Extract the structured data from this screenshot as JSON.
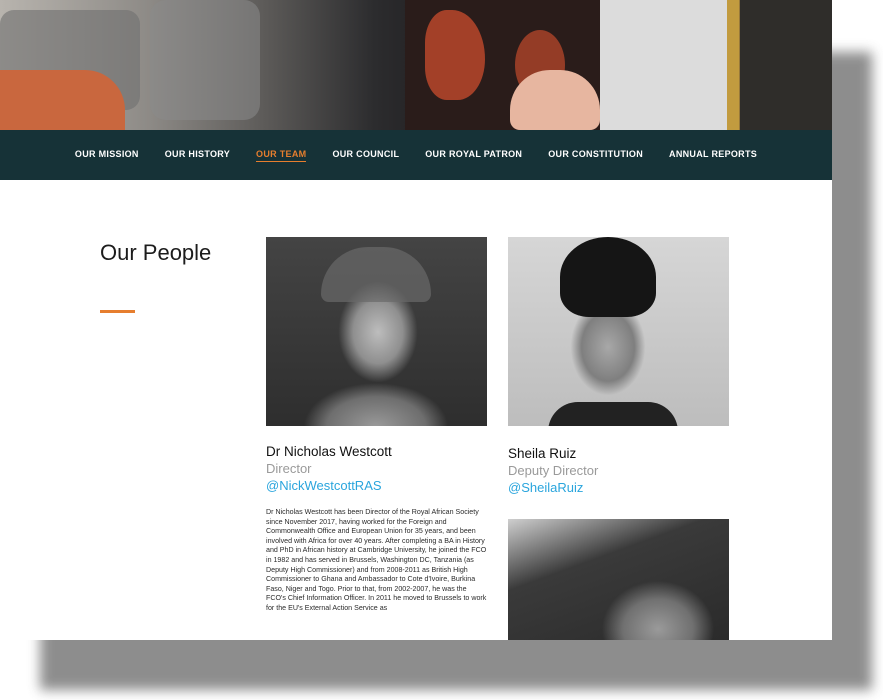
{
  "nav": {
    "items": [
      {
        "label": "OUR MISSION"
      },
      {
        "label": "OUR HISTORY"
      },
      {
        "label": "OUR TEAM"
      },
      {
        "label": "OUR COUNCIL"
      },
      {
        "label": "OUR ROYAL PATRON"
      },
      {
        "label": "OUR CONSTITUTION"
      },
      {
        "label": "ANNUAL REPORTS"
      }
    ],
    "active": "OUR TEAM"
  },
  "section": {
    "title": "Our People"
  },
  "people": [
    {
      "name": "Dr Nicholas Westcott",
      "role": "Director",
      "handle": "@NickWestcottRAS",
      "bio": "Dr Nicholas Westcott has been Director of the Royal African Society since November 2017, having worked for the Foreign and Commonwealth Office and European Union for 35 years, and been involved with Africa for over 40 years. After completing a BA in History and PhD in African history at Cambridge University, he joined the FCO in 1982 and has served in Brussels, Washington DC, Tanzania (as Deputy High Commissioner) and from 2008-2011 as British High Commissioner to Ghana and Ambassador to Cote d'Ivoire, Burkina Faso, Niger and Togo. Prior to that, from 2002-2007, he was the FCO's Chief Information Officer.  In 2011 he moved to Brussels to work for the EU's External Action Service as"
    },
    {
      "name": "Sheila Ruiz",
      "role": "Deputy Director",
      "handle": "@SheilaRuiz"
    }
  ],
  "colors": {
    "nav_bg": "#163237",
    "accent": "#e67e2e",
    "link": "#2aa5dd",
    "muted": "#9a9a9a"
  }
}
